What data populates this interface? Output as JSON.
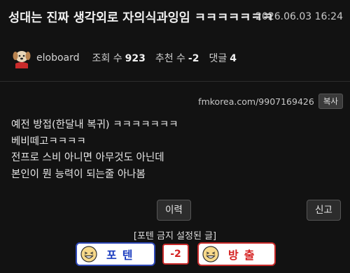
{
  "post": {
    "title": "성대는 진짜 생각외로 자의식과잉임 ㅋㅋㅋㅋㅋㅋㅋ",
    "date": "2026.06.03 16:24",
    "author": "eloboard",
    "views_label": "조회 수",
    "views": "923",
    "recommend_label": "추천 수",
    "recommend": "-2",
    "comments_label": "댓글",
    "comments": "4",
    "url": "fmkorea.com/9907169426",
    "copy_label": "복사",
    "body": [
      "예전 방접(한달내 복귀) ㅋㅋㅋㅋㅋㅋㅋ",
      "베비떼고ㅋㅋㅋㅋ",
      "전프로 스비 아니면 아무것도 아닌데",
      "본인이 뭔 능력이 되는줄 아나봄"
    ]
  },
  "actions": {
    "history_label": "이력",
    "report_label": "신고"
  },
  "vote": {
    "notice": "[포텐 금지 설정된 글]",
    "up_label": "포텐",
    "score": "-2",
    "down_label": "방출"
  },
  "colors": {
    "background": "#121212",
    "up_border": "#2f49b7",
    "down_border": "#c82a2a"
  },
  "icons": {
    "avatar": "puppy-avatar-icon",
    "up_face": "laughing-face-icon",
    "down_face": "laughing-face-icon"
  }
}
